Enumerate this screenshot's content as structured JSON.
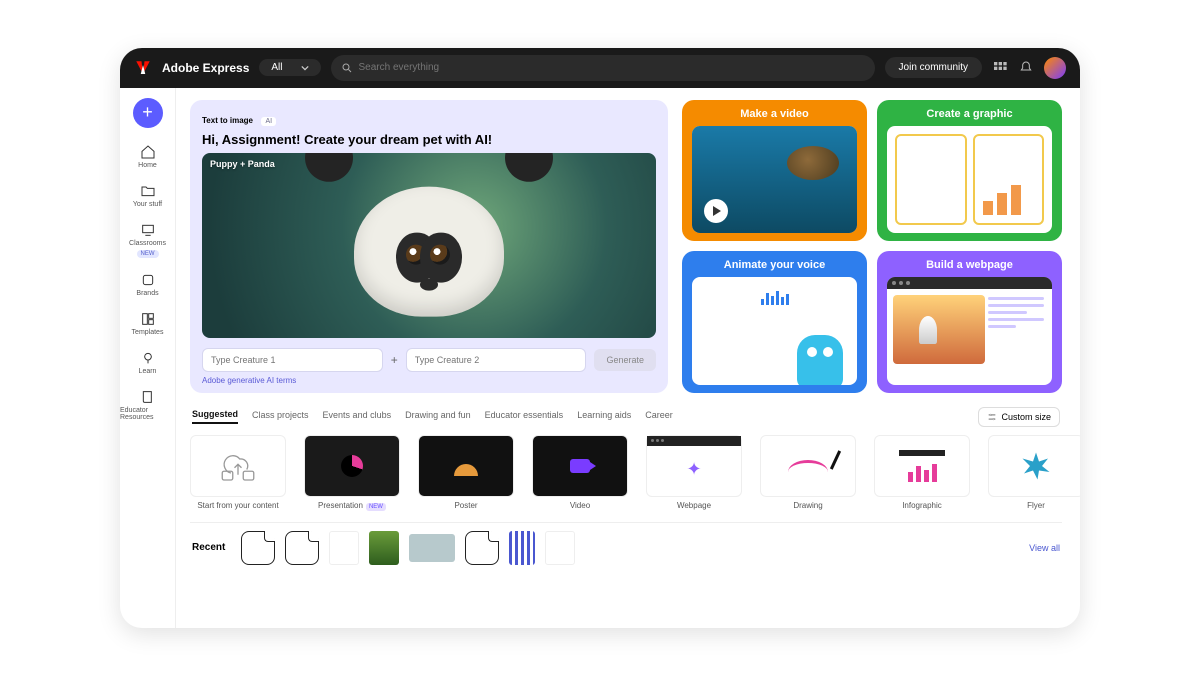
{
  "header": {
    "brand": "Adobe Express",
    "filter_label": "All",
    "search_placeholder": "Search everything",
    "join_label": "Join community"
  },
  "sidebar": {
    "items": [
      {
        "label": "Home"
      },
      {
        "label": "Your stuff"
      },
      {
        "label": "Classrooms",
        "badge": "NEW"
      },
      {
        "label": "Brands"
      },
      {
        "label": "Templates"
      },
      {
        "label": "Learn"
      },
      {
        "label": "Educator Resources"
      }
    ]
  },
  "tti": {
    "tag": "Text to image",
    "ai_badge": "AI",
    "headline": "Hi, Assignment! Create your dream pet with AI!",
    "preview_label": "Puppy + Panda",
    "creature1_placeholder": "Type Creature 1",
    "creature2_placeholder": "Type Creature 2",
    "plus": "+",
    "generate": "Generate",
    "terms": "Adobe generative AI terms"
  },
  "cards": [
    {
      "title": "Make a video"
    },
    {
      "title": "Create a graphic"
    },
    {
      "title": "Animate your voice"
    },
    {
      "title": "Build a webpage"
    }
  ],
  "tabs": {
    "items": [
      "Suggested",
      "Class projects",
      "Events and clubs",
      "Drawing and fun",
      "Educator essentials",
      "Learning aids",
      "Career"
    ],
    "custom_size": "Custom size"
  },
  "templates": [
    {
      "label": "Start from your content"
    },
    {
      "label": "Presentation",
      "badge": "NEW"
    },
    {
      "label": "Poster"
    },
    {
      "label": "Video"
    },
    {
      "label": "Webpage"
    },
    {
      "label": "Drawing"
    },
    {
      "label": "Infographic"
    },
    {
      "label": "Flyer"
    }
  ],
  "recent": {
    "label": "Recent",
    "view_all": "View all"
  }
}
